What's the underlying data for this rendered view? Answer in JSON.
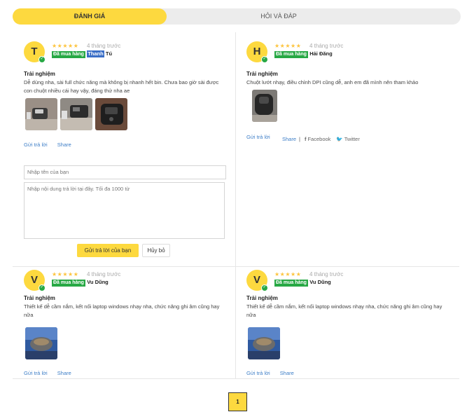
{
  "tabs": [
    {
      "label": "ĐÁNH GIÁ"
    },
    {
      "label": "HỎI VÀ ĐÁP"
    }
  ],
  "reviews": [
    {
      "initial": "T",
      "stars": "★★★★★",
      "time": "4 tháng trước",
      "bought_label": "Đã mua hàng",
      "name_highlight": "Thanh",
      "name_rest": "Tú",
      "exp_title": "Trải nghiệm",
      "text": "Dễ dùng nha, sài full chức năng mà không bị nhanh hết bin. Chưa bao giờ sài được con chuột nhiều cái hay vậy, đáng thử nha ae",
      "reply": "Gửi trả lời",
      "share": "Share"
    },
    {
      "initial": "H",
      "stars": "★★★★★",
      "time": "4 tháng trước",
      "bought_label": "Đã mua hàng",
      "name": "Hải Đăng",
      "exp_title": "Trải nghiệm",
      "text": "Chuột lướt nhạy, điều chỉnh DPI cũng dễ, anh em đã mình nên tham khảo",
      "reply": "Gửi trả lời",
      "share": "Share",
      "separator": "|",
      "facebook": "Facebook",
      "twitter": "Twitter"
    },
    {
      "initial": "V",
      "stars": "★★★★★",
      "time": "4 tháng trước",
      "bought_label": "Đã mua hàng",
      "name": "Vu Dũng",
      "exp_title": "Trải nghiệm",
      "text": "Thiết kế dễ cầm nắm, kết nối laptop windows nhạy nha, chức năng ghi âm cũng hay nữa",
      "reply": "Gửi trả lời",
      "share": "Share"
    },
    {
      "initial": "V",
      "stars": "★★★★★",
      "time": "4 tháng trước",
      "bought_label": "Đã mua hàng",
      "name": "Vu Dũng",
      "exp_title": "Trải nghiệm",
      "text": "Thiết kế dễ cầm nắm, kết nối laptop windows nhạy nha, chức năng ghi âm cũng hay nữa",
      "reply": "Gửi trả lời",
      "share": "Share"
    }
  ],
  "reply_form": {
    "name_placeholder": "Nhập tên của bạn",
    "content_placeholder": "Nhập nội dung trả lời tại đây. Tối đa 1000 từ",
    "send_label": "Gửi trả lời của bạn",
    "cancel_label": "Hủy bỏ"
  },
  "pagination": {
    "current": "1"
  },
  "colors": {
    "accent": "#fdd93f",
    "bought": "#27a844",
    "link": "#3d7ec7"
  }
}
